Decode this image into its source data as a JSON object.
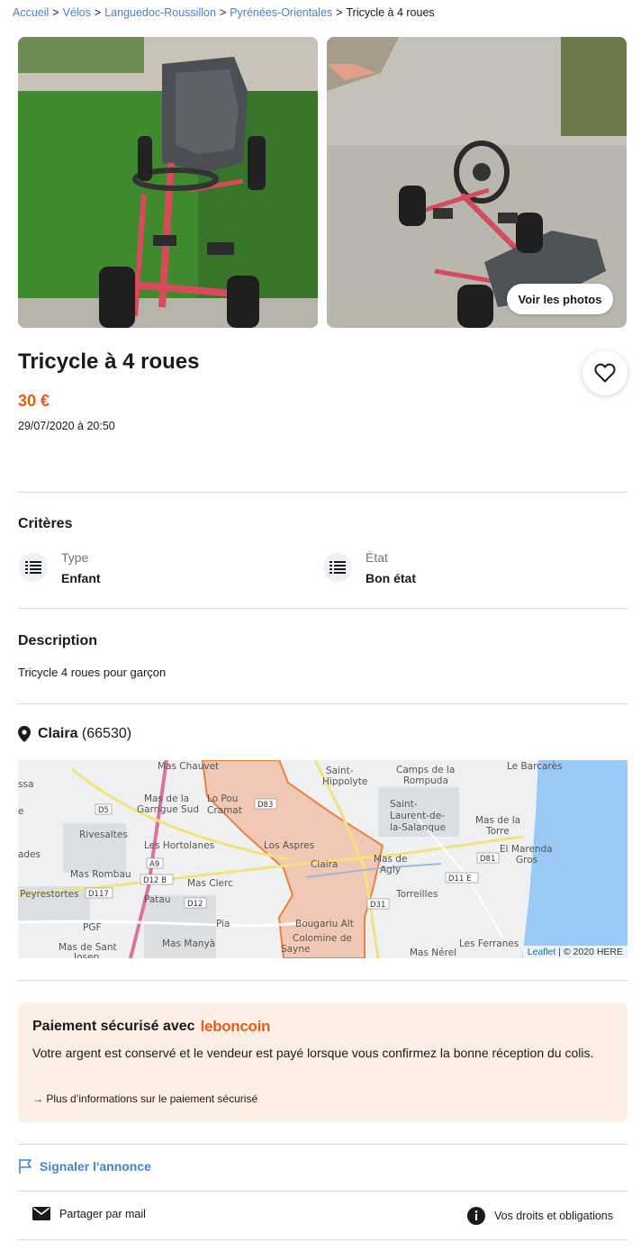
{
  "breadcrumb": {
    "items": [
      "Accueil",
      "Vélos",
      "Languedoc-Roussillon",
      "Pyrénées-Orientales"
    ],
    "current": "Tricycle à 4 roues",
    "separator": ">"
  },
  "gallery": {
    "see_photos_label": "Voir les photos"
  },
  "ad": {
    "title": "Tricycle à 4 roues",
    "price": "30 €",
    "date": "29/07/2020 à 20:50"
  },
  "criteria": {
    "title": "Critères",
    "items": [
      {
        "label": "Type",
        "value": "Enfant"
      },
      {
        "label": "État",
        "value": "Bon état"
      }
    ]
  },
  "description": {
    "title": "Description",
    "text": "Tricycle 4 roues pour garçon"
  },
  "location": {
    "city": "Claira",
    "postcode": "(66530)"
  },
  "map": {
    "labels": [
      "Mas Chauvet",
      "Saint-",
      "Hippolyte",
      "Camps de la",
      "Rompuda",
      "Le Barcarès",
      "Mas de la",
      "Garrigue Sud",
      "Lo Pou",
      "Cramat",
      "Saint-",
      "Laurent-de-",
      "la-Salanque",
      "Mas de la",
      "Torre",
      "Rivesaltes",
      "Les Hortolanes",
      "Los Aspres",
      "El Marenda",
      "Gros",
      "Claira",
      "Mas de",
      "Agly",
      "Mas Rombau",
      "Mas Clerc",
      "Torreilles",
      "Peyrestortes",
      "Patau",
      "Pia",
      "Bougariu Alt",
      "PGF",
      "Mas de Sant",
      "Josep",
      "Mas Manyà",
      "Colomine de",
      "Sayne",
      "Mas Nérel",
      "Les Ferranes",
      "ssa",
      "ades",
      "e"
    ],
    "road_labels": [
      "D5",
      "D83",
      "A9",
      "D12 B",
      "D117",
      "D12",
      "D31",
      "D11 E",
      "D81"
    ],
    "attribution_link": "Leaflet",
    "attribution_sep": "|",
    "attribution_text": "© 2020 HERE",
    "sea_color": "#99c9f4",
    "zone_color": "#f2b79c"
  },
  "payment": {
    "title": "Paiement sécurisé avec",
    "brand": "leboncoin",
    "text": "Votre argent est conservé et le vendeur est payé lorsque vous confirmez la bonne réception du colis.",
    "link": "Plus d’informations sur le paiement sécurisé"
  },
  "footer": {
    "report": "Signaler l'annonce",
    "share": "Partager par mail",
    "rights": "Vos droits et obligations"
  },
  "colors": {
    "accent_orange": "#ec5a13",
    "link_blue": "#4183d7",
    "payment_bg": "#fdeee6"
  }
}
